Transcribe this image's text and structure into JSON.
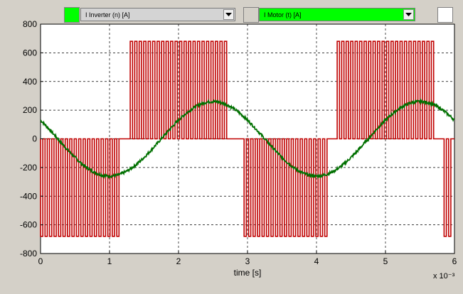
{
  "toolbar": {
    "series1_color": "#00ff00",
    "series1_select": "I Inverter (n) [A]",
    "series2_color": "#d4d0c8",
    "series2_select": "I Motor (t) [A]",
    "series2_select_bg": "#00ff00",
    "extra_color": "#ffffff",
    "dropdown_icon": "chevron-down-icon"
  },
  "chart_data": {
    "type": "line",
    "xlabel": "time [s]",
    "x_exponent": "x 10⁻³",
    "xlim": [
      0,
      6
    ],
    "ylim": [
      -800,
      800
    ],
    "x_ticks": [
      "0",
      "1",
      "2",
      "3",
      "4",
      "5",
      "6"
    ],
    "y_ticks": [
      "800",
      "600",
      "400",
      "200",
      "0",
      "-200",
      "-400",
      "-600",
      "-800"
    ],
    "grid": true,
    "series": [
      {
        "name": "I Inverter (n) [A]",
        "color": "#c00000",
        "style": "pwm",
        "amplitude": 680,
        "negative_intervals": [
          [
            0.0,
            1.2
          ],
          [
            2.95,
            4.2
          ]
        ],
        "positive_intervals": [
          [
            1.3,
            2.75
          ],
          [
            4.3,
            5.75
          ]
        ],
        "negative_intervals_2": [
          [
            5.85,
            6.0
          ]
        ],
        "pulse_period": 0.065
      },
      {
        "name": "I Motor (t) [A]",
        "color": "#007000",
        "style": "sine",
        "amplitude": 260,
        "period": 3.0,
        "peak_x": 2.5
      }
    ]
  }
}
